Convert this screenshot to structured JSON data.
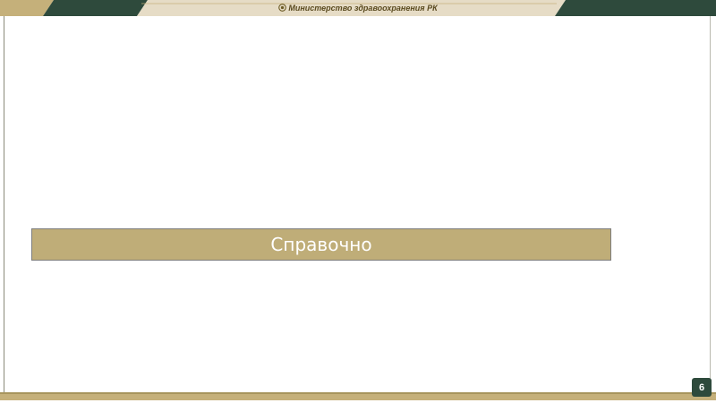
{
  "header": {
    "ministry_title": "Министерство здравоохранения РК",
    "emblem_icon": "emblem-icon"
  },
  "main": {
    "banner_text": "Справочно"
  },
  "footer": {
    "page_number": "6"
  },
  "colors": {
    "dark_green": "#2e4a3c",
    "gold": "#bfad78",
    "beige": "#e6dcc6"
  }
}
